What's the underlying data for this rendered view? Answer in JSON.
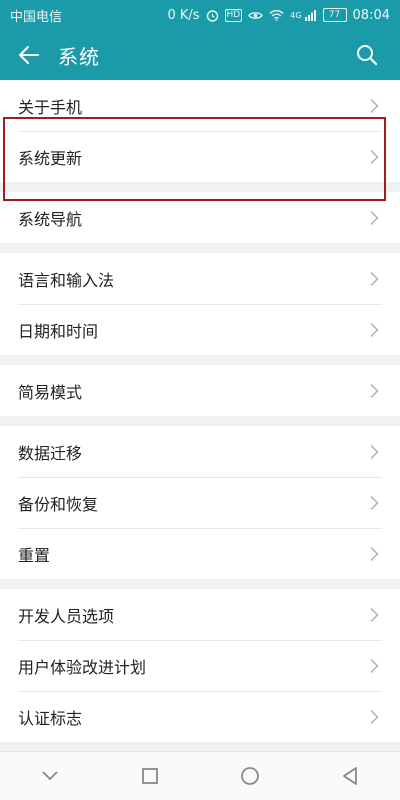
{
  "status_bar": {
    "carrier": "中国电信",
    "speed": "0 K/s",
    "hd_label": "HD",
    "network_type": "4G",
    "battery": "77",
    "time": "08:04"
  },
  "header": {
    "title": "系统"
  },
  "groups": [
    {
      "items": [
        {
          "label": "关于手机"
        },
        {
          "label": "系统更新"
        }
      ]
    },
    {
      "items": [
        {
          "label": "系统导航"
        }
      ]
    },
    {
      "items": [
        {
          "label": "语言和输入法"
        },
        {
          "label": "日期和时间"
        }
      ]
    },
    {
      "items": [
        {
          "label": "简易模式"
        }
      ]
    },
    {
      "items": [
        {
          "label": "数据迁移"
        },
        {
          "label": "备份和恢复"
        },
        {
          "label": "重置"
        }
      ]
    },
    {
      "items": [
        {
          "label": "开发人员选项"
        },
        {
          "label": "用户体验改进计划"
        },
        {
          "label": "认证标志"
        }
      ]
    }
  ],
  "colors": {
    "accent": "#1b9aa8",
    "highlight_border": "#a51a1a"
  },
  "icons": {
    "back": "arrow-left-icon",
    "search": "search-icon",
    "chevron": "chevron-right-icon",
    "nav_collapse": "chevron-down-icon",
    "nav_recent": "square-icon",
    "nav_home": "circle-icon",
    "nav_back": "triangle-back-icon"
  }
}
